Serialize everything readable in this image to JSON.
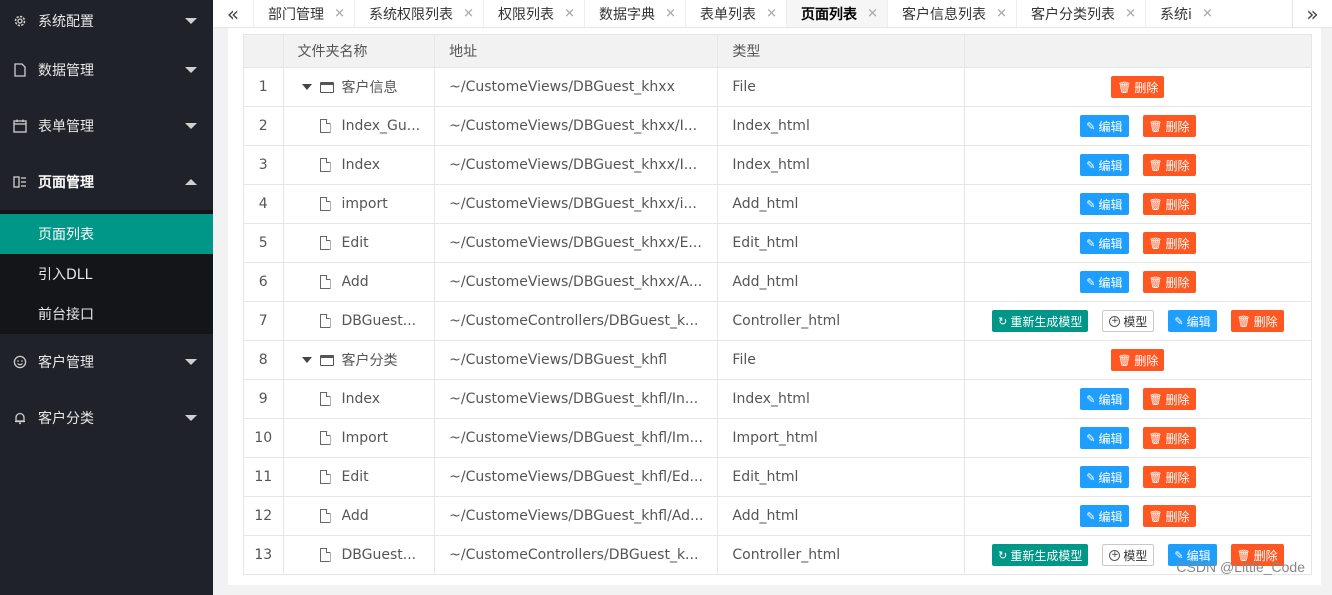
{
  "sidebar": {
    "items": [
      {
        "label": "系统配置",
        "icon": "gear-icon"
      },
      {
        "label": "数据管理",
        "icon": "document-icon"
      },
      {
        "label": "表单管理",
        "icon": "calendar-icon"
      },
      {
        "label": "页面管理",
        "icon": "page-manage-icon"
      }
    ],
    "subitems": [
      "页面列表",
      "引入DLL",
      "前台接口"
    ],
    "items_after": [
      {
        "label": "客户管理",
        "icon": "smile-icon"
      },
      {
        "label": "客户分类",
        "icon": "bell-icon"
      }
    ]
  },
  "tabs": [
    {
      "label": "部门管理"
    },
    {
      "label": "系统权限列表"
    },
    {
      "label": "权限列表"
    },
    {
      "label": "数据字典"
    },
    {
      "label": "表单列表"
    },
    {
      "label": "页面列表",
      "active": true
    },
    {
      "label": "客户信息列表"
    },
    {
      "label": "客户分类列表"
    },
    {
      "label": "系统i"
    }
  ],
  "table": {
    "headers": [
      "",
      "文件夹名称",
      "地址",
      "类型",
      ""
    ],
    "rows": [
      {
        "num": "1",
        "name": "客户信息",
        "kind": "folder",
        "path": "~/CustomeViews/DBGuest_khxx",
        "type": "File"
      },
      {
        "num": "2",
        "name": "Index_Gu...",
        "kind": "file",
        "path": "~/CustomeViews/DBGuest_khxx/I...",
        "type": "Index_html"
      },
      {
        "num": "3",
        "name": "Index",
        "kind": "file",
        "path": "~/CustomeViews/DBGuest_khxx/I...",
        "type": "Index_html"
      },
      {
        "num": "4",
        "name": "import",
        "kind": "file",
        "path": "~/CustomeViews/DBGuest_khxx/i...",
        "type": "Add_html"
      },
      {
        "num": "5",
        "name": "Edit",
        "kind": "file",
        "path": "~/CustomeViews/DBGuest_khxx/E...",
        "type": "Edit_html"
      },
      {
        "num": "6",
        "name": "Add",
        "kind": "file",
        "path": "~/CustomeViews/DBGuest_khxx/A...",
        "type": "Add_html"
      },
      {
        "num": "7",
        "name": "DBGuest...",
        "kind": "controller",
        "path": "~/CustomeControllers/DBGuest_k...",
        "type": "Controller_html"
      },
      {
        "num": "8",
        "name": "客户分类",
        "kind": "folder",
        "path": "~/CustomeViews/DBGuest_khfl",
        "type": "File"
      },
      {
        "num": "9",
        "name": "Index",
        "kind": "file",
        "path": "~/CustomeViews/DBGuest_khfl/In...",
        "type": "Index_html"
      },
      {
        "num": "10",
        "name": "Import",
        "kind": "file",
        "path": "~/CustomeViews/DBGuest_khfl/Im...",
        "type": "Import_html"
      },
      {
        "num": "11",
        "name": "Edit",
        "kind": "file",
        "path": "~/CustomeViews/DBGuest_khfl/Ed...",
        "type": "Edit_html"
      },
      {
        "num": "12",
        "name": "Add",
        "kind": "file",
        "path": "~/CustomeViews/DBGuest_khfl/Ad...",
        "type": "Add_html"
      },
      {
        "num": "13",
        "name": "DBGuest...",
        "kind": "controller",
        "path": "~/CustomeControllers/DBGuest_k...",
        "type": "Controller_html"
      }
    ]
  },
  "buttons": {
    "edit": "编辑",
    "delete": "删除",
    "regen": "重新生成模型",
    "model": "模型"
  },
  "watermark": "CSDN @Little_Code",
  "colors": {
    "sidebar_bg": "#20222a",
    "active_teal": "#009688",
    "edit_blue": "#1e9fff",
    "delete_orange": "#ff5722"
  }
}
